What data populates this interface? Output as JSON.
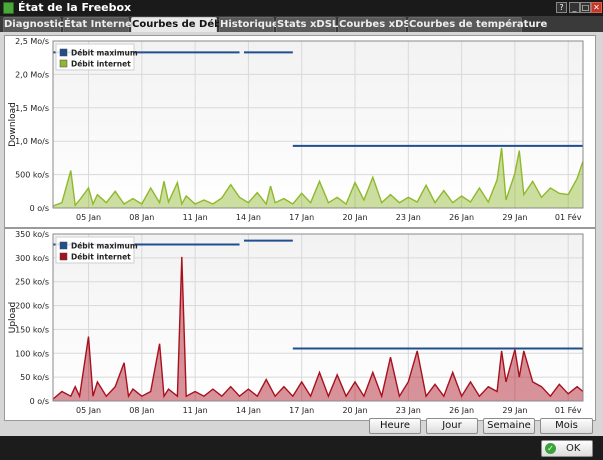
{
  "window": {
    "title": "État de la Freebox",
    "buttons": [
      "?",
      "_",
      "□",
      "✕"
    ]
  },
  "tabs": [
    {
      "label": "Diagnostic",
      "active": false
    },
    {
      "label": "État Internet",
      "active": false
    },
    {
      "label": "Courbes de Débit",
      "active": true
    },
    {
      "label": "Historique",
      "active": false
    },
    {
      "label": "Stats xDSL",
      "active": false
    },
    {
      "label": "Courbes xDSL",
      "active": false
    },
    {
      "label": "Courbes de température",
      "active": false
    }
  ],
  "colors": {
    "max_line": "#1f4f8f",
    "download": "#8fb82c",
    "upload": "#a8101e"
  },
  "chart_data": [
    {
      "type": "area",
      "ylabel": "Download",
      "y_ticks": [
        "0 o/s",
        "500 ko/s",
        "1,0 Mo/s",
        "1,5 Mo/s",
        "2,0 Mo/s",
        "2,5 Mo/s"
      ],
      "y_tick_values": [
        0,
        500,
        1000,
        1500,
        2000,
        2500
      ],
      "ylim": [
        0,
        2500
      ],
      "unit": "ko/s",
      "x_ticks": [
        "05 Jan",
        "08 Jan",
        "11 Jan",
        "14 Jan",
        "17 Jan",
        "20 Jan",
        "23 Jan",
        "26 Jan",
        "29 Jan",
        "01 Fév"
      ],
      "xlim": [
        "2013-01-03",
        "2013-02-01T20:00"
      ],
      "grid": true,
      "legend_position": "top-left",
      "legend": [
        "Débit maximum",
        "Débit internet"
      ],
      "series": [
        {
          "name": "Débit maximum",
          "segments": [
            {
              "from": "2013-01-03",
              "to": "2013-01-13T12:00",
              "value": 2330
            },
            {
              "from": "2013-01-13T18:00",
              "to": "2013-01-16T12:00",
              "value": 2330
            },
            {
              "from": "2013-01-16T12:00",
              "to": "2013-02-01T20:00",
              "value": 930
            }
          ]
        },
        {
          "name": "Débit internet",
          "points": [
            [
              "2013-01-03",
              30
            ],
            [
              "2013-01-03T12:00",
              80
            ],
            [
              "2013-01-04",
              560
            ],
            [
              "2013-01-04T06:00",
              40
            ],
            [
              "2013-01-04T12:00",
              120
            ],
            [
              "2013-01-05",
              300
            ],
            [
              "2013-01-05T06:00",
              60
            ],
            [
              "2013-01-05T12:00",
              200
            ],
            [
              "2013-01-06",
              80
            ],
            [
              "2013-01-06T12:00",
              250
            ],
            [
              "2013-01-07",
              60
            ],
            [
              "2013-01-07T12:00",
              140
            ],
            [
              "2013-01-08",
              60
            ],
            [
              "2013-01-08T12:00",
              300
            ],
            [
              "2013-01-09",
              80
            ],
            [
              "2013-01-09T06:00",
              400
            ],
            [
              "2013-01-09T12:00",
              90
            ],
            [
              "2013-01-10",
              380
            ],
            [
              "2013-01-10T06:00",
              60
            ],
            [
              "2013-01-10T12:00",
              180
            ],
            [
              "2013-01-11",
              60
            ],
            [
              "2013-01-11T12:00",
              120
            ],
            [
              "2013-01-12",
              60
            ],
            [
              "2013-01-12T12:00",
              150
            ],
            [
              "2013-01-13",
              350
            ],
            [
              "2013-01-13T12:00",
              160
            ],
            [
              "2013-01-14",
              80
            ],
            [
              "2013-01-14T12:00",
              230
            ],
            [
              "2013-01-15",
              60
            ],
            [
              "2013-01-15T06:00",
              330
            ],
            [
              "2013-01-15T12:00",
              80
            ],
            [
              "2013-01-16",
              140
            ],
            [
              "2013-01-16T12:00",
              60
            ],
            [
              "2013-01-17",
              220
            ],
            [
              "2013-01-17T12:00",
              80
            ],
            [
              "2013-01-18",
              400
            ],
            [
              "2013-01-18T12:00",
              80
            ],
            [
              "2013-01-19",
              160
            ],
            [
              "2013-01-19T12:00",
              60
            ],
            [
              "2013-01-20",
              380
            ],
            [
              "2013-01-20T12:00",
              120
            ],
            [
              "2013-01-21",
              460
            ],
            [
              "2013-01-21T12:00",
              80
            ],
            [
              "2013-01-22",
              200
            ],
            [
              "2013-01-22T12:00",
              80
            ],
            [
              "2013-01-23",
              160
            ],
            [
              "2013-01-23T12:00",
              90
            ],
            [
              "2013-01-24",
              340
            ],
            [
              "2013-01-24T12:00",
              80
            ],
            [
              "2013-01-25",
              260
            ],
            [
              "2013-01-25T12:00",
              80
            ],
            [
              "2013-01-26",
              180
            ],
            [
              "2013-01-26T12:00",
              90
            ],
            [
              "2013-01-27",
              300
            ],
            [
              "2013-01-27T12:00",
              90
            ],
            [
              "2013-01-28",
              420
            ],
            [
              "2013-01-28T06:00",
              900
            ],
            [
              "2013-01-28T12:00",
              120
            ],
            [
              "2013-01-29",
              520
            ],
            [
              "2013-01-29T06:00",
              860
            ],
            [
              "2013-01-29T12:00",
              200
            ],
            [
              "2013-01-30",
              400
            ],
            [
              "2013-01-30T12:00",
              160
            ],
            [
              "2013-01-31",
              300
            ],
            [
              "2013-01-31T12:00",
              220
            ],
            [
              "2013-02-01",
              200
            ],
            [
              "2013-02-01T12:00",
              440
            ],
            [
              "2013-02-01T20:00",
              700
            ]
          ]
        }
      ]
    },
    {
      "type": "area",
      "ylabel": "Upload",
      "y_ticks": [
        "0 o/s",
        "50 ko/s",
        "100 ko/s",
        "150 ko/s",
        "200 ko/s",
        "250 ko/s",
        "300 ko/s",
        "350 ko/s"
      ],
      "y_tick_values": [
        0,
        50,
        100,
        150,
        200,
        250,
        300,
        350
      ],
      "ylim": [
        0,
        350
      ],
      "unit": "ko/s",
      "x_ticks": [
        "05 Jan",
        "08 Jan",
        "11 Jan",
        "14 Jan",
        "17 Jan",
        "20 Jan",
        "23 Jan",
        "26 Jan",
        "29 Jan",
        "01 Fév"
      ],
      "xlim": [
        "2013-01-03",
        "2013-02-01T20:00"
      ],
      "grid": true,
      "legend_position": "top-left",
      "legend": [
        "Débit maximum",
        "Débit internet"
      ],
      "series": [
        {
          "name": "Débit maximum",
          "segments": [
            {
              "from": "2013-01-03",
              "to": "2013-01-13T12:00",
              "value": 328
            },
            {
              "from": "2013-01-13T18:00",
              "to": "2013-01-16T12:00",
              "value": 336
            },
            {
              "from": "2013-01-16T12:00",
              "to": "2013-02-01T20:00",
              "value": 110
            }
          ]
        },
        {
          "name": "Débit internet",
          "points": [
            [
              "2013-01-03",
              4
            ],
            [
              "2013-01-03T12:00",
              20
            ],
            [
              "2013-01-04",
              10
            ],
            [
              "2013-01-04T06:00",
              30
            ],
            [
              "2013-01-04T12:00",
              10
            ],
            [
              "2013-01-05",
              135
            ],
            [
              "2013-01-05T06:00",
              10
            ],
            [
              "2013-01-05T12:00",
              40
            ],
            [
              "2013-01-06",
              10
            ],
            [
              "2013-01-06T12:00",
              30
            ],
            [
              "2013-01-07",
              80
            ],
            [
              "2013-01-07T06:00",
              10
            ],
            [
              "2013-01-07T12:00",
              25
            ],
            [
              "2013-01-08",
              10
            ],
            [
              "2013-01-08T12:00",
              20
            ],
            [
              "2013-01-09",
              120
            ],
            [
              "2013-01-09T06:00",
              10
            ],
            [
              "2013-01-09T12:00",
              25
            ],
            [
              "2013-01-10",
              10
            ],
            [
              "2013-01-10T06:00",
              302
            ],
            [
              "2013-01-10T12:00",
              10
            ],
            [
              "2013-01-11",
              20
            ],
            [
              "2013-01-11T12:00",
              10
            ],
            [
              "2013-01-12",
              25
            ],
            [
              "2013-01-12T12:00",
              10
            ],
            [
              "2013-01-13",
              30
            ],
            [
              "2013-01-13T12:00",
              10
            ],
            [
              "2013-01-14",
              25
            ],
            [
              "2013-01-14T12:00",
              10
            ],
            [
              "2013-01-15",
              45
            ],
            [
              "2013-01-15T12:00",
              10
            ],
            [
              "2013-01-16",
              30
            ],
            [
              "2013-01-16T12:00",
              10
            ],
            [
              "2013-01-17",
              40
            ],
            [
              "2013-01-17T12:00",
              10
            ],
            [
              "2013-01-18",
              60
            ],
            [
              "2013-01-18T12:00",
              10
            ],
            [
              "2013-01-19",
              55
            ],
            [
              "2013-01-19T12:00",
              10
            ],
            [
              "2013-01-20",
              40
            ],
            [
              "2013-01-20T12:00",
              10
            ],
            [
              "2013-01-21",
              60
            ],
            [
              "2013-01-21T12:00",
              10
            ],
            [
              "2013-01-22",
              92
            ],
            [
              "2013-01-22T12:00",
              10
            ],
            [
              "2013-01-23",
              40
            ],
            [
              "2013-01-23T12:00",
              105
            ],
            [
              "2013-01-24",
              10
            ],
            [
              "2013-01-24T12:00",
              35
            ],
            [
              "2013-01-25",
              10
            ],
            [
              "2013-01-25T12:00",
              60
            ],
            [
              "2013-01-26",
              10
            ],
            [
              "2013-01-26T12:00",
              40
            ],
            [
              "2013-01-27",
              10
            ],
            [
              "2013-01-27T12:00",
              30
            ],
            [
              "2013-01-28",
              20
            ],
            [
              "2013-01-28T06:00",
              105
            ],
            [
              "2013-01-28T12:00",
              40
            ],
            [
              "2013-01-29",
              108
            ],
            [
              "2013-01-29T06:00",
              50
            ],
            [
              "2013-01-29T12:00",
              105
            ],
            [
              "2013-01-30",
              40
            ],
            [
              "2013-01-30T12:00",
              30
            ],
            [
              "2013-01-31",
              10
            ],
            [
              "2013-01-31T12:00",
              35
            ],
            [
              "2013-02-01",
              15
            ],
            [
              "2013-02-01T12:00",
              30
            ],
            [
              "2013-02-01T20:00",
              20
            ]
          ]
        }
      ]
    }
  ],
  "range_buttons": [
    "Heure",
    "Jour",
    "Semaine",
    "Mois"
  ],
  "ok_button": {
    "label": "OK",
    "icon": "check-icon"
  }
}
